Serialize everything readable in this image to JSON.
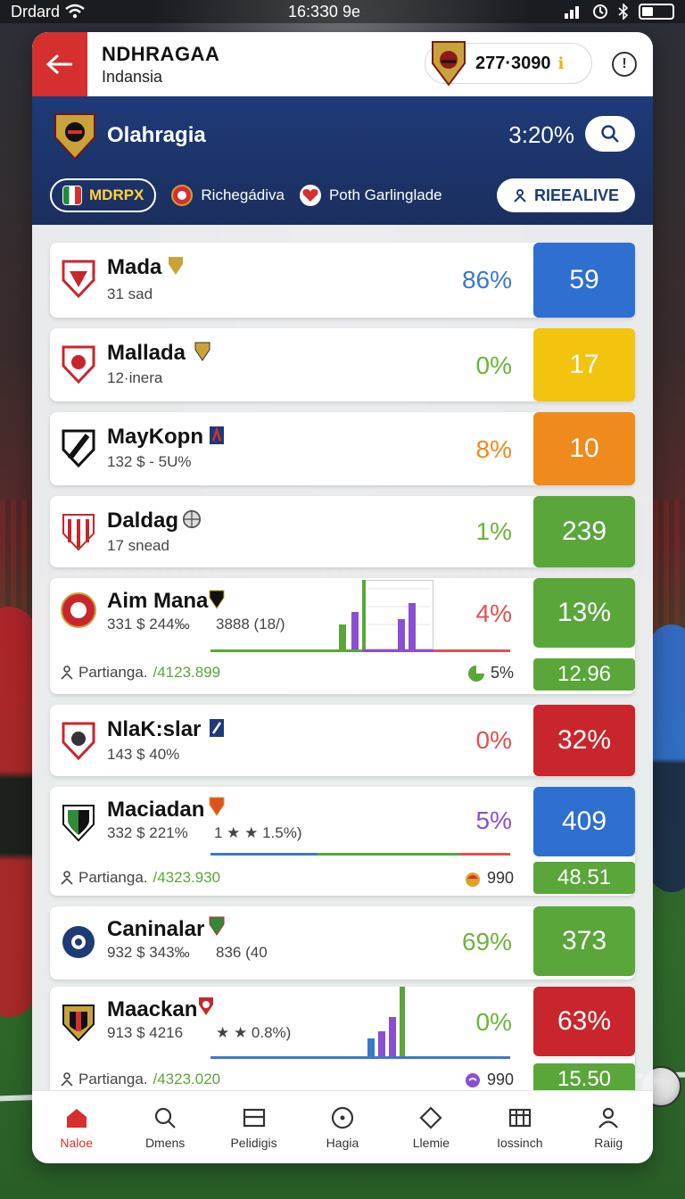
{
  "status_bar": {
    "carrier": "Drdard",
    "time": "16:3З0 9е"
  },
  "header": {
    "title": "NDHRAGAA",
    "subtitle": "Indansia",
    "balance": "277·3090"
  },
  "banner": {
    "title": "Olahragia",
    "percent": "3:20%",
    "filters": [
      {
        "label": "MDRPX",
        "active": true
      },
      {
        "label": "Richegádiva",
        "active": false
      },
      {
        "label": "Poth Garlinglade",
        "active": false
      }
    ],
    "live_label": "RIEEALIVE"
  },
  "rows": [
    {
      "name": "Mada",
      "meta": "31 ‌sad",
      "pct": "86%",
      "pct_color": "#3a78d0",
      "score": "59",
      "score_color": "#2f6fd0"
    },
    {
      "name": "Mallada",
      "meta": "12·inera",
      "pct": "0%",
      "pct_color": "#6bb43a",
      "score": "17",
      "score_color": "#f2c40f"
    },
    {
      "name": "MayKopn",
      "meta": "132   $ ‑ 5U%",
      "pct": "8%",
      "pct_color": "#ef8a1c",
      "score": "10",
      "score_color": "#ef8a1c"
    },
    {
      "name": "Daldag",
      "meta": "17 snead",
      "pct": "1%",
      "pct_color": "#6bb43a",
      "score": "239",
      "score_color": "#5aa63a"
    },
    {
      "name": "Aim Mana",
      "meta": "331   $  244‰",
      "meta_extra": "3888 (18/)",
      "pct": "4%",
      "pct_color": "#e05050",
      "score": "13%",
      "score_color": "#5aa63a",
      "sub_label": "Partianga.",
      "sub_value": "/4123.899",
      "sub_pct": "5%",
      "sub_score": "12.96"
    },
    {
      "name": "NlaK:slar",
      "meta": "143   $  40%",
      "pct": "0%",
      "pct_color": "#e05050",
      "score": "32%",
      "score_color": "#c8262c"
    },
    {
      "name": "Maciadan",
      "meta": "332   $  221%",
      "meta_extra": "1 ★ ★ 1.5%)",
      "pct": "5%",
      "pct_color": "#8a4fd0",
      "score": "409",
      "score_color": "#2f6fd0",
      "sub_label": "Partianga.",
      "sub_value": "/4323.930",
      "sub_pct": "990",
      "sub_score": "48.51"
    },
    {
      "name": "Caninalar",
      "meta": "932   $  343‰",
      "meta_extra": "836 (40",
      "pct": "69%",
      "pct_color": "#6bb43a",
      "score": "373",
      "score_color": "#5aa63a"
    },
    {
      "name": "Maackan",
      "meta": "913   $  4216",
      "meta_extra": "★ ★ 0.8%)",
      "pct": "0%",
      "pct_color": "#6bb43a",
      "score": "63%",
      "score_color": "#c8262c",
      "sub_label": "Partianga.",
      "sub_value": "/4323.020",
      "sub_pct": "990",
      "sub_score": "15.50"
    }
  ],
  "nav": [
    {
      "label": "Naloe",
      "icon": "home-icon",
      "active": true
    },
    {
      "label": "Dmens",
      "icon": "search-icon",
      "active": false
    },
    {
      "label": "Pelidigis",
      "icon": "card-icon",
      "active": false
    },
    {
      "label": "Hagia",
      "icon": "compass-icon",
      "active": false
    },
    {
      "label": "Llemie",
      "icon": "diamond-icon",
      "active": false
    },
    {
      "label": "Iossinch",
      "icon": "table-icon",
      "active": false
    },
    {
      "label": "Raiig",
      "icon": "user-icon",
      "active": false
    }
  ]
}
